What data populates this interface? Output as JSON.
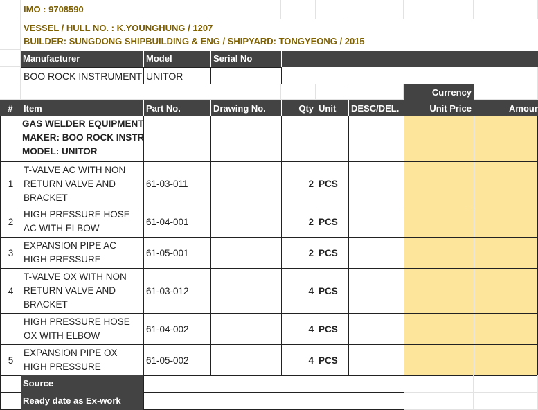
{
  "imo": "IMO : 9708590",
  "vessel": "VESSEL / HULL NO. : K.YOUNGHUNG / 1207",
  "builder": "BUILDER: SUNGDONG SHIPBUILDING & ENG / SHIPYARD: TONGYEONG / 2015",
  "equip_headers": {
    "manufacturer": "Manufacturer",
    "model": "Model",
    "serial": "Serial No"
  },
  "equip": {
    "manufacturer": "BOO ROCK INSTRUMENT",
    "model": "UNITOR",
    "serial": ""
  },
  "currency_label": "Currency",
  "headers": {
    "num": "#",
    "item": "Item",
    "part": "Part No.",
    "drawing": "Drawing No.",
    "qty": "Qty",
    "unit": "Unit",
    "desc": "DESC/DEL.",
    "unit_price": "Unit Price",
    "amount": "Amount"
  },
  "group": {
    "line1": "GAS WELDER EQUIPMENT",
    "line2": "MAKER: BOO ROCK INSTRUMENT",
    "line3": "MODEL: UNITOR"
  },
  "rows": [
    {
      "num": "1",
      "item": "T-VALVE AC WITH NON RETURN VALVE AND BRACKET",
      "part": "61-03-011",
      "qty": "2",
      "unit": "PCS"
    },
    {
      "num": "2",
      "item": "HIGH PRESSURE HOSE AC WITH ELBOW",
      "part": "61-04-001",
      "qty": "2",
      "unit": "PCS"
    },
    {
      "num": "3",
      "item": "EXPANSION PIPE AC HIGH PRESSURE",
      "part": "61-05-001",
      "qty": "2",
      "unit": "PCS"
    },
    {
      "num": "4",
      "item": "T-VALVE OX WITH NON RETURN VALVE AND BRACKET",
      "part": "61-03-012",
      "qty": "4",
      "unit": "PCS"
    },
    {
      "num": "",
      "item": "HIGH PRESSURE HOSE OX WITH ELBOW",
      "part": "61-04-002",
      "qty": "4",
      "unit": "PCS"
    },
    {
      "num": "5",
      "item": "EXPANSION PIPE OX HIGH PRESSURE",
      "part": "61-05-002",
      "qty": "4",
      "unit": "PCS"
    }
  ],
  "footer": {
    "source": "Source",
    "ready": "Ready date as Ex-work"
  },
  "colors": {
    "header_dark": "#434343",
    "price_fill": "#fde59c",
    "title_text": "#7f6000"
  }
}
